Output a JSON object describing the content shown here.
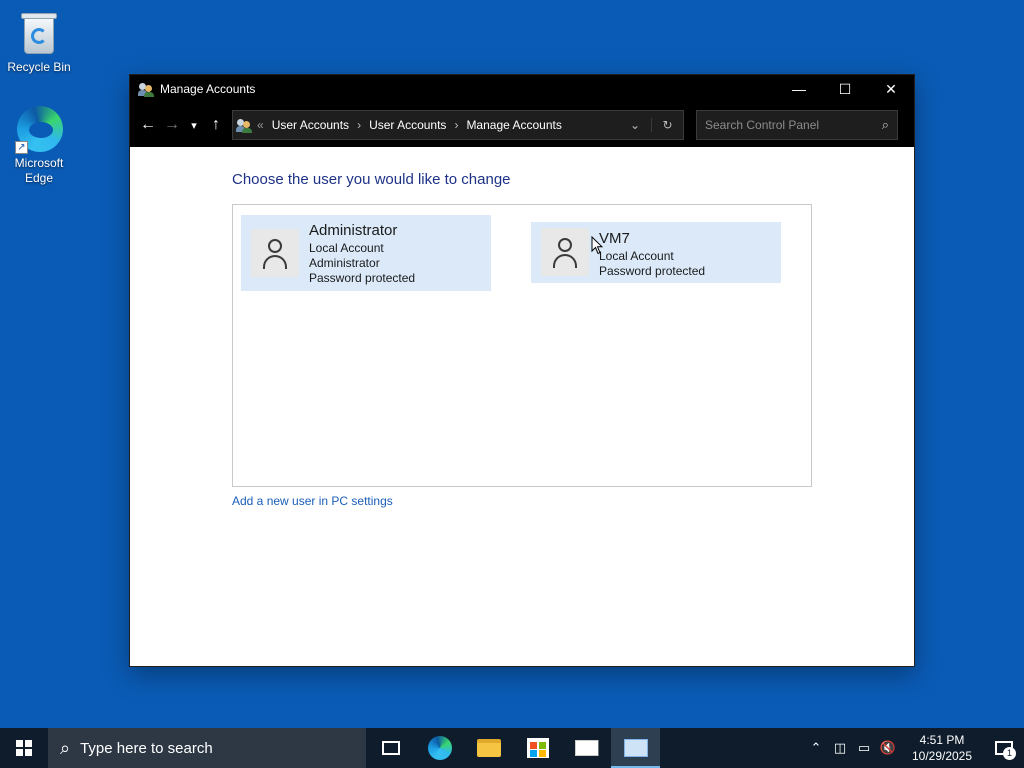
{
  "desktop": {
    "icons": [
      {
        "label": "Recycle Bin"
      },
      {
        "label": "Microsoft Edge"
      }
    ]
  },
  "window": {
    "title": "Manage Accounts",
    "controls": {
      "minimize": "—",
      "maximize": "☐",
      "close": "✕"
    }
  },
  "nav": {
    "back": "←",
    "forward": "→",
    "recent": "▾",
    "up": "↑",
    "breadcrumb": [
      "User Accounts",
      "User Accounts",
      "Manage Accounts"
    ],
    "overflow": "«",
    "dropdown": "⌄",
    "refresh": "↻"
  },
  "search": {
    "placeholder": "Search Control Panel",
    "icon": "search-icon"
  },
  "main": {
    "heading": "Choose the user you would like to change",
    "accounts": [
      {
        "name": "Administrator",
        "lines": [
          "Local Account",
          "Administrator",
          "Password protected"
        ]
      },
      {
        "name": "VM7",
        "lines": [
          "Local Account",
          "Password protected"
        ]
      }
    ],
    "add_user_link": "Add a new user in PC settings"
  },
  "taskbar": {
    "search_placeholder": "Type here to search",
    "time": "4:51 PM",
    "date": "10/29/2025",
    "notification_count": "1"
  },
  "colors": {
    "desktop": "#0a5bb5",
    "heading": "#1e3287",
    "link": "#1a5eb8",
    "account_tile": "#dbe9f9",
    "taskbar": "#0f1c2b"
  }
}
